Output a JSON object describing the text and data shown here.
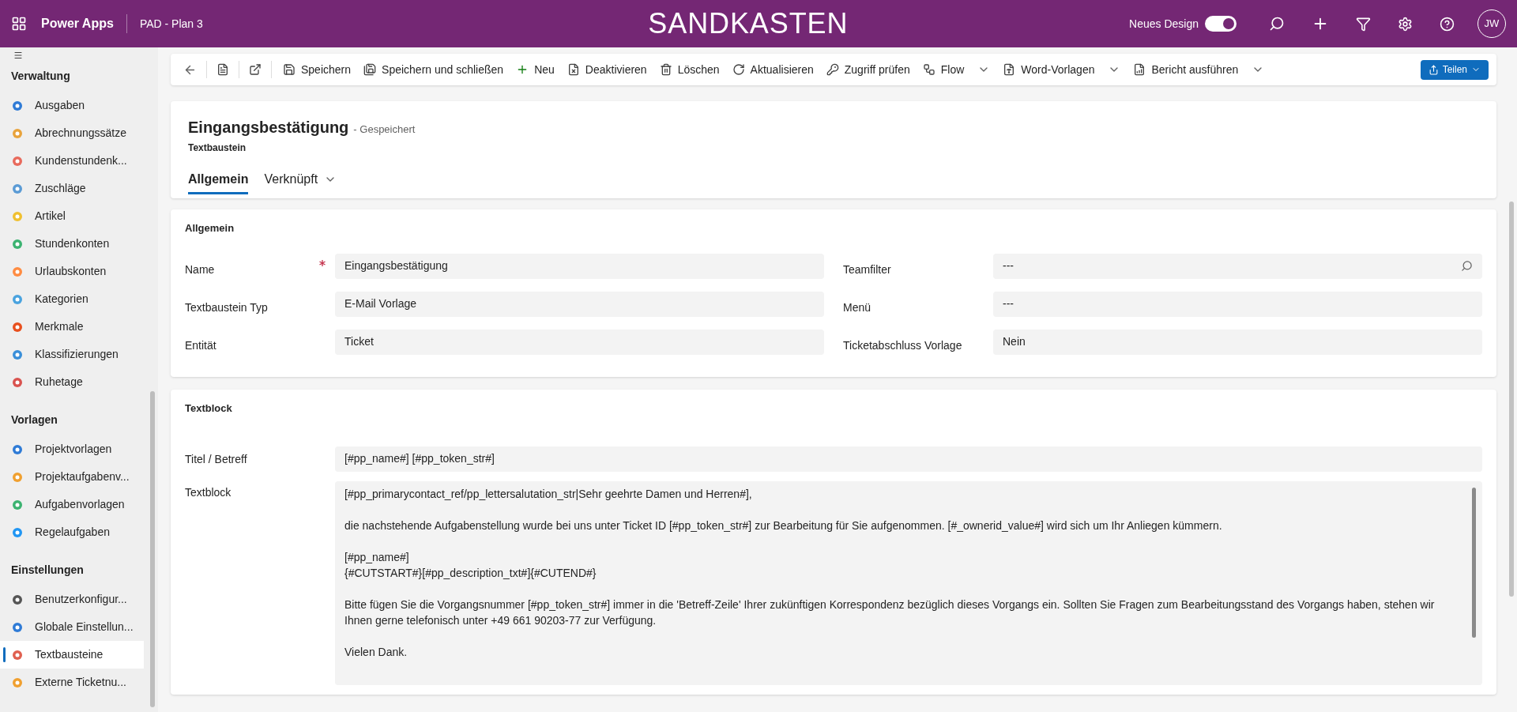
{
  "topbar": {
    "app_name": "Power Apps",
    "environment": "PAD - Plan 3",
    "banner": "SANDKASTEN",
    "new_design_label": "Neues Design",
    "new_design_on": true,
    "avatar": "JW"
  },
  "sidebar": {
    "groups": [
      {
        "title": "Verwaltung",
        "items": [
          {
            "label": "Ausgaben",
            "selected": false
          },
          {
            "label": "Abrechnungssätze",
            "selected": false
          },
          {
            "label": "Kundenstundenk...",
            "selected": false
          },
          {
            "label": "Zuschläge",
            "selected": false
          },
          {
            "label": "Artikel",
            "selected": false
          },
          {
            "label": "Stundenkonten",
            "selected": false
          },
          {
            "label": "Urlaubskonten",
            "selected": false
          },
          {
            "label": "Kategorien",
            "selected": false
          },
          {
            "label": "Merkmale",
            "selected": false
          },
          {
            "label": "Klassifizierungen",
            "selected": false
          },
          {
            "label": "Ruhetage",
            "selected": false
          }
        ]
      },
      {
        "title": "Vorlagen",
        "items": [
          {
            "label": "Projektvorlagen",
            "selected": false
          },
          {
            "label": "Projektaufgabenv...",
            "selected": false
          },
          {
            "label": "Aufgabenvorlagen",
            "selected": false
          },
          {
            "label": "Regelaufgaben",
            "selected": false
          }
        ]
      },
      {
        "title": "Einstellungen",
        "items": [
          {
            "label": "Benutzerkonfigur...",
            "selected": false
          },
          {
            "label": "Globale Einstellun...",
            "selected": false
          },
          {
            "label": "Textbausteine",
            "selected": true
          },
          {
            "label": "Externe Ticketnu...",
            "selected": false
          }
        ]
      }
    ]
  },
  "toolbar": {
    "commands": [
      {
        "label": "Speichern",
        "has_menu": false
      },
      {
        "label": "Speichern und schließen",
        "has_menu": false
      },
      {
        "label": "Neu",
        "has_menu": false
      },
      {
        "label": "Deaktivieren",
        "has_menu": false
      },
      {
        "label": "Löschen",
        "has_menu": false
      },
      {
        "label": "Aktualisieren",
        "has_menu": false
      },
      {
        "label": "Zugriff prüfen",
        "has_menu": false
      },
      {
        "label": "Flow",
        "has_menu": true
      },
      {
        "label": "Word-Vorlagen",
        "has_menu": true
      },
      {
        "label": "Bericht ausführen",
        "has_menu": true
      }
    ],
    "share_label": "Teilen"
  },
  "record": {
    "title": "Eingangsbestätigung",
    "status": "- Gespeichert",
    "entity": "Textbaustein",
    "tabs": [
      {
        "label": "Allgemein",
        "selected": true,
        "has_menu": false
      },
      {
        "label": "Verknüpft",
        "selected": false,
        "has_menu": true
      }
    ]
  },
  "section_general": {
    "title": "Allgemein",
    "left_fields": [
      {
        "label": "Name",
        "value": "Eingangsbestätigung",
        "required": true,
        "lookup": false
      },
      {
        "label": "Textbaustein Typ",
        "value": "E-Mail Vorlage",
        "required": false,
        "lookup": false
      },
      {
        "label": "Entität",
        "value": "Ticket",
        "required": false,
        "lookup": false
      }
    ],
    "right_fields": [
      {
        "label": "Teamfilter",
        "value": "---",
        "required": false,
        "lookup": true
      },
      {
        "label": "Menü",
        "value": "---",
        "required": false,
        "lookup": false
      },
      {
        "label": "Ticketabschluss Vorlage",
        "value": "Nein",
        "required": false,
        "lookup": false
      }
    ]
  },
  "section_textblock": {
    "title": "Textblock",
    "subject_label": "Titel / Betreff",
    "subject_value": "[#pp_name#] [#pp_token_str#]",
    "body_label": "Textblock",
    "body_paragraphs": [
      [
        "[#pp_primarycontact_ref/pp_lettersalutation_str|Sehr geehrte Damen und Herren#],"
      ],
      [
        "die nachstehende Aufgabenstellung wurde bei uns unter Ticket ID [#pp_token_str#] zur Bearbeitung für Sie aufgenommen. [#_ownerid_value#] wird sich um Ihr Anliegen kümmern."
      ],
      [
        "[#pp_name#]",
        "{#CUTSTART#}[#pp_description_txt#]{#CUTEND#}"
      ],
      [
        "Bitte fügen Sie die Vorgangsnummer [#pp_token_str#] immer in die 'Betreff-Zeile' Ihrer zukünftigen Korrespondenz bezüglich dieses Vorgangs ein. Sollten Sie Fragen zum Bearbeitungsstand des Vorgangs haben, stehen wir Ihnen gerne telefonisch unter +49 661 90203-77 zur Verfügung."
      ],
      [
        "Vielen Dank."
      ]
    ]
  }
}
